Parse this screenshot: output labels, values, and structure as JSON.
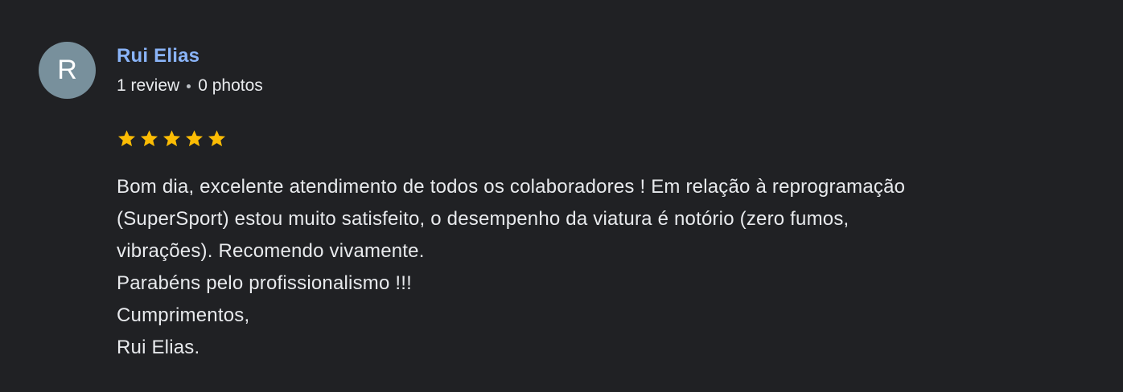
{
  "reviewer": {
    "initial": "R",
    "avatar_color": "#78909c",
    "name": "Rui Elias",
    "name_color": "#8ab4f8",
    "review_count": "1 review",
    "photo_count": "0 photos"
  },
  "rating": {
    "stars": 5,
    "max_stars": 5,
    "star_color": "#fbbc04",
    "icon": "star-icon"
  },
  "review": {
    "lines": [
      "Bom dia, excelente atendimento de todos os colaboradores ! Em relação à reprogramação",
      "(SuperSport) estou muito satisfeito, o desempenho da viatura é notório (zero fumos,",
      "vibrações). Recomendo vivamente.",
      "Parabéns pelo profissionalismo !!!",
      "Cumprimentos,",
      "Rui Elias."
    ]
  },
  "colors": {
    "background": "#202124",
    "text": "#e8eaed"
  }
}
